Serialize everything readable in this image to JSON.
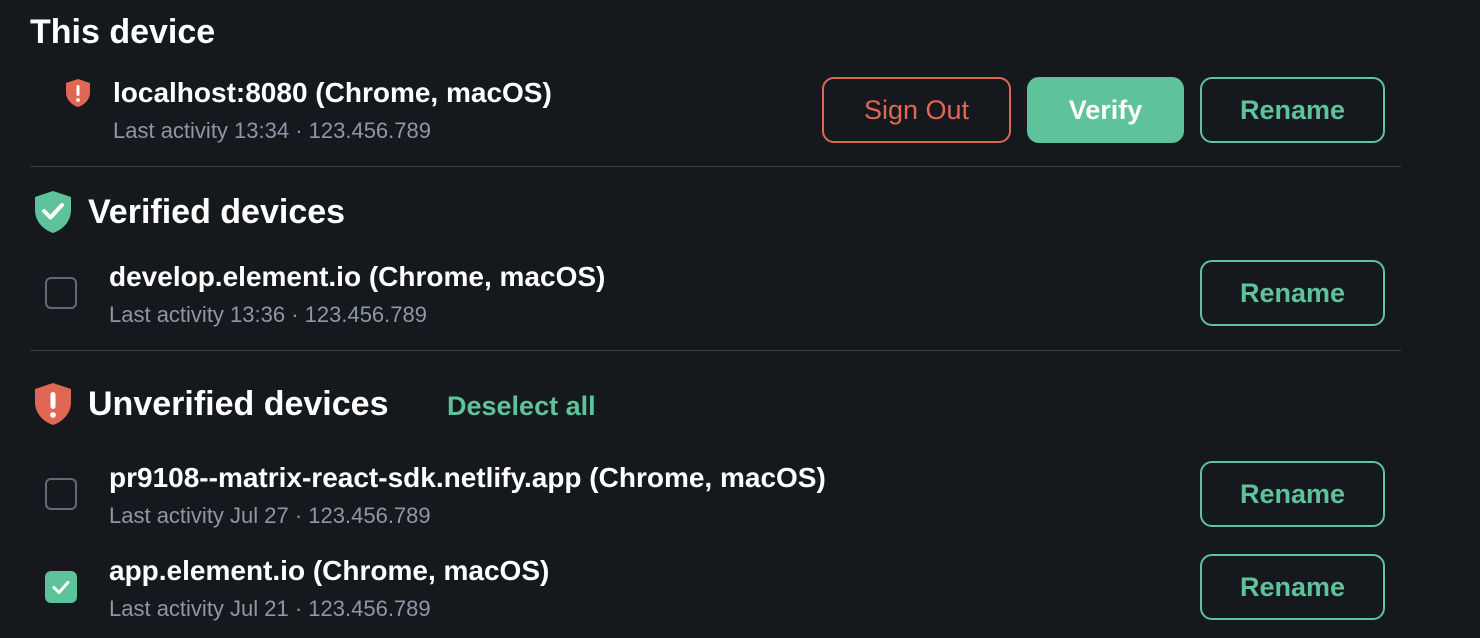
{
  "this_device": {
    "heading": "This device",
    "name": "localhost:8080 (Chrome, macOS)",
    "meta": "Last activity 13:34 · 123.456.789",
    "buttons": {
      "sign_out": "Sign Out",
      "verify": "Verify",
      "rename": "Rename"
    }
  },
  "verified": {
    "heading": "Verified devices",
    "devices": [
      {
        "name": "develop.element.io (Chrome, macOS)",
        "meta": "Last activity 13:36 · 123.456.789",
        "checked": false,
        "rename_label": "Rename"
      }
    ]
  },
  "unverified": {
    "heading": "Unverified devices",
    "deselect_all": "Deselect all",
    "devices": [
      {
        "name": "pr9108--matrix-react-sdk.netlify.app (Chrome, macOS)",
        "meta": "Last activity Jul 27 · 123.456.789",
        "checked": false,
        "rename_label": "Rename"
      },
      {
        "name": "app.element.io (Chrome, macOS)",
        "meta": "Last activity Jul 21 · 123.456.789",
        "checked": true,
        "rename_label": "Rename"
      }
    ]
  },
  "icons": {
    "verified_shield": "shield-check-icon",
    "unverified_shield": "shield-alert-icon",
    "checkmark": "checkmark-icon"
  },
  "colors": {
    "background": "#15191e",
    "accent_green": "#5ec39a",
    "alert_red": "#e06754",
    "secondary_text": "#8d97a5",
    "divider": "#394049"
  }
}
